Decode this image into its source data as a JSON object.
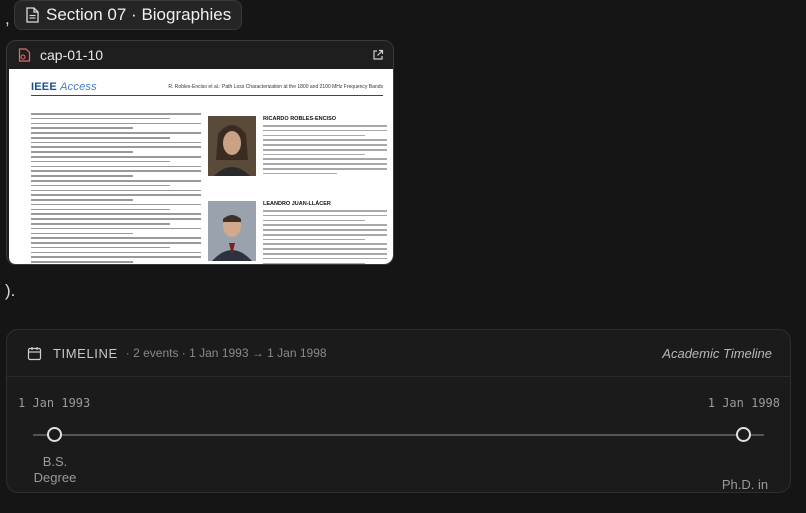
{
  "prefix_text": ",",
  "section_chip": {
    "icon": "document-icon",
    "label": "Section 07 · Biographies"
  },
  "card": {
    "icon": "image-attachment-icon",
    "title": "cap-01-10",
    "external_icon": "open-external-icon",
    "paper": {
      "logo_bold": "IEEE",
      "logo_italic": "Access",
      "running_head": "R. Robles-Enciso et al.: Path Loss Characterization at the 1800 and 2100 MHz Frequency Bands",
      "bio1_name": "RICARDO ROBLES-ENCISO",
      "bio2_name": "LEANDRO JUAN-LLÁCER"
    }
  },
  "suffix_text": ").",
  "timeline": {
    "icon": "calendar-icon",
    "title": "TIMELINE",
    "meta": "· 2 events · 1 Jan 1993 → 1 Jan 1998",
    "name": "Academic Timeline",
    "start_date": "1 Jan 1993",
    "end_date": "1 Jan 1998",
    "events": [
      {
        "label": "B.S. Degree"
      },
      {
        "label": "Ph.D. in"
      }
    ]
  }
}
